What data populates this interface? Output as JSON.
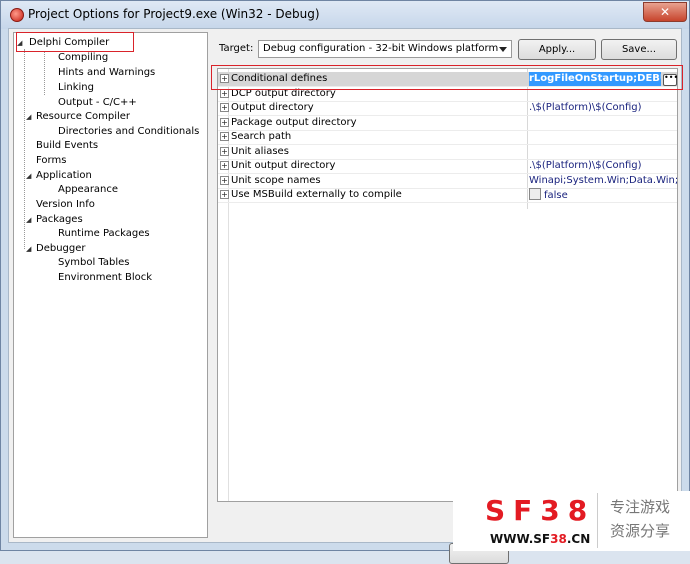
{
  "window": {
    "title": "Project Options for Project9.exe  (Win32 - Debug)",
    "close_label": "✕"
  },
  "tree": {
    "items": [
      {
        "label": "Delphi Compiler",
        "expander": "◢",
        "selected": true
      },
      {
        "label": "Compiling"
      },
      {
        "label": "Hints and Warnings"
      },
      {
        "label": "Linking"
      },
      {
        "label": "Output - C/C++"
      },
      {
        "label": "Resource Compiler",
        "expander": "◢"
      },
      {
        "label": "Directories and Conditionals"
      },
      {
        "label": "Build Events"
      },
      {
        "label": "Forms"
      },
      {
        "label": "Application",
        "expander": "◢"
      },
      {
        "label": "Appearance"
      },
      {
        "label": "Version Info"
      },
      {
        "label": "Packages",
        "expander": "◢"
      },
      {
        "label": "Runtime Packages"
      },
      {
        "label": "Debugger",
        "expander": "◢"
      },
      {
        "label": "Symbol Tables"
      },
      {
        "label": "Environment Block"
      }
    ]
  },
  "target": {
    "label": "Target:",
    "value": "Debug configuration - 32-bit Windows platform"
  },
  "buttons": {
    "apply": "Apply...",
    "save": "Save...",
    "ellipsis": "•••"
  },
  "grid": {
    "rows": [
      {
        "name": "Conditional defines",
        "value": "rLogFileOnStartup;DEBUG"
      },
      {
        "name": "DCP output directory",
        "value": ""
      },
      {
        "name": "Output directory",
        "value": ".\\$(Platform)\\$(Config)"
      },
      {
        "name": "Package output directory",
        "value": ""
      },
      {
        "name": "Search path",
        "value": ""
      },
      {
        "name": "Unit aliases",
        "value": ""
      },
      {
        "name": "Unit output directory",
        "value": ".\\$(Platform)\\$(Config)"
      },
      {
        "name": "Unit scope names",
        "value": "Winapi;System.Win;Data.Win;Da"
      },
      {
        "name": "Use MSBuild externally to compile",
        "value": "false"
      }
    ]
  },
  "watermark": {
    "brand": "SF38",
    "url_prefix": "WWW.SF",
    "url_number": "38",
    "url_suffix": ".CN",
    "cn_line1": "专注游戏",
    "cn_line2": "资源分享"
  },
  "colors": {
    "selection": "#3399ff",
    "highlight_box": "#d9232a",
    "value_text": "#1a237e"
  }
}
